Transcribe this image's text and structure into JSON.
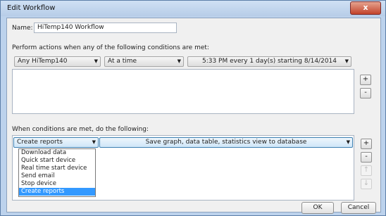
{
  "window": {
    "title": "Edit Workflow",
    "close_glyph": "x"
  },
  "name": {
    "label": "Name:",
    "value": "HiTemp140 Workflow"
  },
  "conditions": {
    "heading": "Perform actions when any of the following conditions are met:",
    "sensor": "Any HiTemp140",
    "timing": "At a time",
    "schedule": "5:33 PM every 1 day(s) starting 8/14/2014",
    "add_label": "+",
    "remove_label": "-"
  },
  "actions": {
    "heading": "When conditions are met, do the following:",
    "action_type": "Create reports",
    "action_detail": "Save graph, data table, statistics view to database",
    "options": [
      "Download data",
      "Quick start device",
      "Real time start device",
      "Send email",
      "Stop device",
      "Create reports"
    ],
    "selected_index": 5,
    "add_label": "+",
    "remove_label": "-",
    "up_label": "↑",
    "down_label": "↓"
  },
  "footer": {
    "ok_label": "OK",
    "cancel_label": "Cancel"
  },
  "icons": {
    "dropdown_arrow": "chevron-down-icon",
    "close": "close-icon"
  }
}
